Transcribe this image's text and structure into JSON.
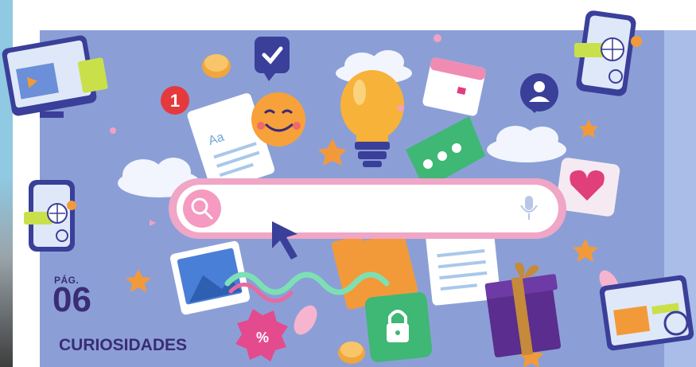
{
  "page_label": {
    "prefix": "PÁG.",
    "number": "06",
    "section": "CURIOSIDADES"
  },
  "illustration": {
    "search_bar_text": "Aa",
    "badge_number": "1",
    "discount_symbol": "%"
  },
  "colors": {
    "background": "#8b9fd6",
    "label": "#3a2c76",
    "search_frame": "#f0a6c6",
    "search_button": "#f59ac0",
    "accent_orange": "#f6a34a"
  },
  "icons": [
    "search-icon",
    "microphone-icon",
    "cursor-arrow-icon",
    "lightbulb-icon",
    "smiley-icon",
    "checkmark-chat-icon",
    "notification-badge-icon",
    "calendar-icon",
    "user-chat-icon",
    "heart-icon",
    "document-icon",
    "image-icon",
    "folder-icon",
    "lock-icon",
    "gift-icon",
    "discount-icon",
    "coin-icon",
    "monitor-icon",
    "phone-map-icon",
    "globe-icon"
  ]
}
